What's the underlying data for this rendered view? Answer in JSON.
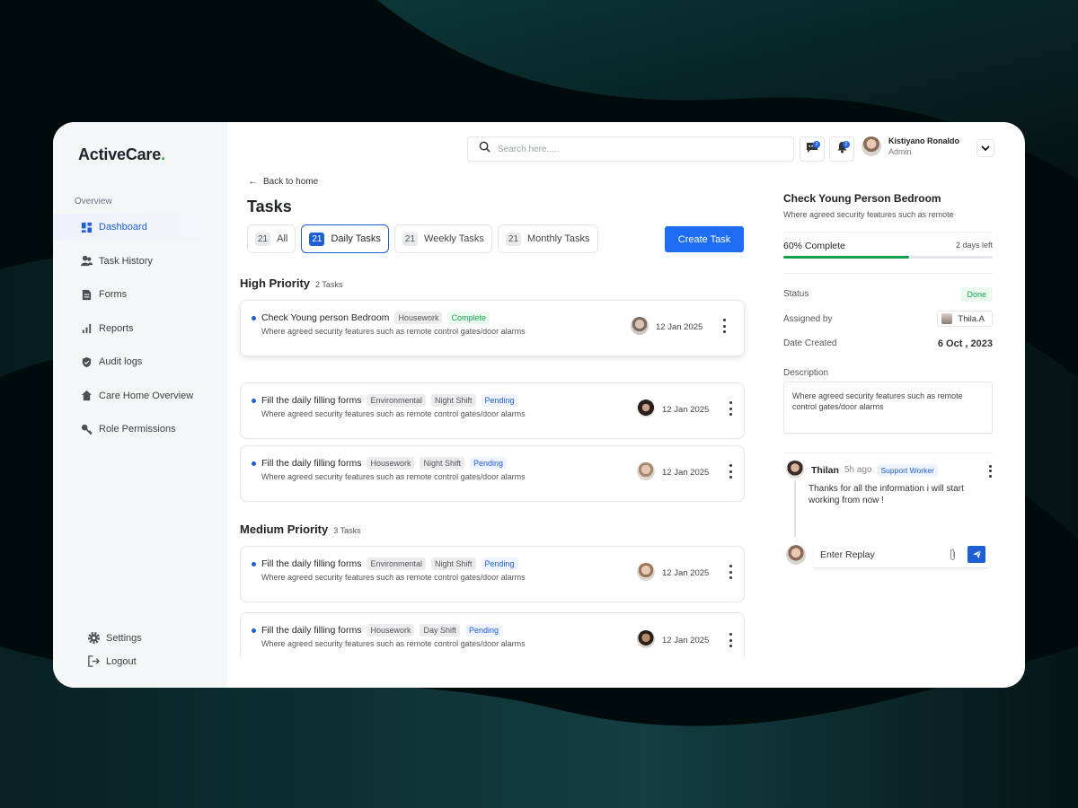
{
  "brand": {
    "name": "ActiveCare",
    "dot": "."
  },
  "sidebar": {
    "section": "Overview",
    "items": [
      {
        "label": "Dashboard",
        "icon": "dashboard-icon",
        "active": true
      },
      {
        "label": "Task History",
        "icon": "users-icon"
      },
      {
        "label": "Forms",
        "icon": "document-icon"
      },
      {
        "label": "Reports",
        "icon": "bar-chart-icon"
      },
      {
        "label": "Audit logs",
        "icon": "shield-icon"
      },
      {
        "label": "Care Home Overview",
        "icon": "home-icon"
      },
      {
        "label": "Role Permissions",
        "icon": "key-icon"
      }
    ],
    "bottom": [
      {
        "label": "Settings",
        "icon": "gear-icon"
      },
      {
        "label": "Logout",
        "icon": "logout-icon"
      }
    ]
  },
  "topbar": {
    "search_placeholder": "Search here.....",
    "messages_badge": "2",
    "notifications_badge": "2",
    "user_name": "Kistiyano Ronaldo",
    "user_role": "Admin"
  },
  "page": {
    "back": "Back to home",
    "title": "Tasks",
    "tabs": [
      {
        "count": "21",
        "label": "All"
      },
      {
        "count": "21",
        "label": "Daily Tasks",
        "active": true
      },
      {
        "count": "21",
        "label": "Weekly Tasks"
      },
      {
        "count": "21",
        "label": "Monthly Tasks"
      }
    ],
    "create_label": "Create Task"
  },
  "sections": [
    {
      "title": "High Priority",
      "count": "2 Tasks"
    },
    {
      "title": "Medium Priority",
      "count": "3 Tasks"
    }
  ],
  "tasks": [
    {
      "title": "Check Young person Bedroom",
      "tags": [
        {
          "text": "Housework",
          "style": "grey"
        },
        {
          "text": "Complete",
          "style": "green"
        }
      ],
      "desc": "Where agreed security features such as remote control gates/door alarms",
      "date": "12 Jan 2025"
    },
    {
      "title": "Fill the daily filling forms",
      "tags": [
        {
          "text": "Environmental",
          "style": "grey"
        },
        {
          "text": "Night Shift",
          "style": "grey"
        },
        {
          "text": "Pending",
          "style": "blue"
        }
      ],
      "desc": "Where agreed security features such as remote control gates/door alarms",
      "date": "12 Jan 2025"
    },
    {
      "title": "Fill the daily filling forms",
      "tags": [
        {
          "text": "Housework",
          "style": "grey"
        },
        {
          "text": "Night Shift",
          "style": "grey"
        },
        {
          "text": "Pending",
          "style": "blue"
        }
      ],
      "desc": "Where agreed security features such as remote control gates/door alarms",
      "date": "12 Jan 2025"
    },
    {
      "title": "Fill the daily filling forms",
      "tags": [
        {
          "text": "Environmental",
          "style": "grey"
        },
        {
          "text": "Night Shift",
          "style": "grey"
        },
        {
          "text": "Pending",
          "style": "blue"
        }
      ],
      "desc": "Where agreed security features such as remote control gates/door alarms",
      "date": "12 Jan 2025"
    },
    {
      "title": "Fill the daily filling forms",
      "tags": [
        {
          "text": "Housework",
          "style": "grey"
        },
        {
          "text": "Day Shift",
          "style": "grey"
        },
        {
          "text": "Pending",
          "style": "blue"
        }
      ],
      "desc": "Where agreed security features such as remote control gates/door alarms",
      "date": "12 Jan 2025"
    }
  ],
  "detail": {
    "title": "Check Young Person Bedroom",
    "subtitle": "Where agreed security features such as remote",
    "progress_label": "60% Complete",
    "progress_value": 0.6,
    "time_left": "2 days left",
    "status_label": "Status",
    "status_value": "Done",
    "assigned_label": "Assigned by",
    "assigned_value": "Thila.A",
    "created_label": "Date Created",
    "created_value": "6 Oct , 2023",
    "description_label": "Description",
    "description_text": "Where agreed security features such as remote control gates/door alarms",
    "comment": {
      "name": "Thilan",
      "time": "5h ago",
      "role": "Support Worker",
      "text": "Thanks for all the information i will start working from now !"
    },
    "reply_placeholder": "Enter Replay"
  },
  "colors": {
    "accent": "#1d6cf2",
    "success": "#14a14a",
    "brand_dot": "#2fb344"
  }
}
